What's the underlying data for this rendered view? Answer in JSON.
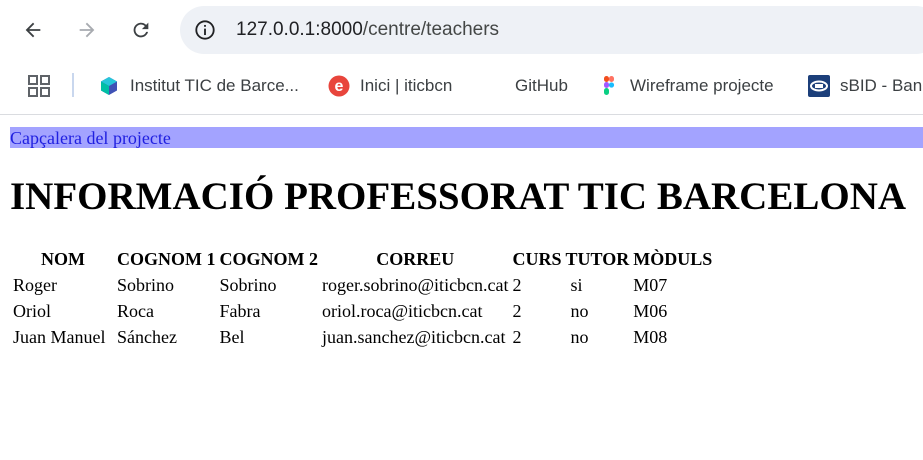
{
  "browser": {
    "url_host": "127.0.0.1:8000",
    "url_path": "/centre/teachers",
    "bookmarks": [
      {
        "label": "Institut TIC de Barce...",
        "icon": "gem-icon"
      },
      {
        "label": "Inici | iticbcn",
        "icon": "e-logo-icon"
      },
      {
        "label": "GitHub",
        "icon": "github-icon"
      },
      {
        "label": "Wireframe projecte",
        "icon": "figma-icon"
      },
      {
        "label": "sBID - Ban",
        "icon": "sbid-icon"
      }
    ]
  },
  "page": {
    "header": "Capçalera del projecte",
    "title": "INFORMACIÓ PROFESSORAT TIC BARCELONA"
  },
  "table": {
    "columns": [
      "NOM",
      "COGNOM 1",
      "COGNOM 2",
      "CORREU",
      "CURS",
      "TUTOR",
      "MÒDULS"
    ],
    "rows": [
      [
        "Roger",
        "Sobrino",
        "Sobrino",
        "roger.sobrino@iticbcn.cat",
        "2",
        "si",
        "M07"
      ],
      [
        "Oriol",
        "Roca",
        "Fabra",
        "oriol.roca@iticbcn.cat",
        "2",
        "no",
        "M06"
      ],
      [
        "Juan Manuel",
        "Sánchez",
        "Bel",
        "juan.sanchez@iticbcn.cat",
        "2",
        "no",
        "M08"
      ]
    ]
  },
  "colors": {
    "header_bg": "#a3a3ff",
    "header_text": "#1f1fe0",
    "omnibox_bg": "#eef1f6"
  }
}
